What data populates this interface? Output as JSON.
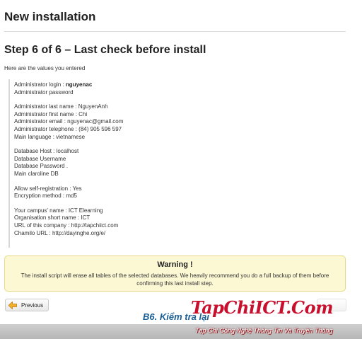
{
  "header": {
    "title": "New installation"
  },
  "step": {
    "title": "Step 6 of 6 – Last check before install"
  },
  "intro": "Here are the values you entered",
  "values": {
    "admin": [
      {
        "label": "Administrator login : ",
        "value": "nguyenac"
      },
      {
        "label": "Administrator password",
        "value": ""
      }
    ],
    "person": [
      {
        "label": "Administrator last name : ",
        "value": "NguyenAnh"
      },
      {
        "label": "Administrator first name : ",
        "value": "Chi"
      },
      {
        "label": "Administrator email : ",
        "value": "nguyenac@gmail.com"
      },
      {
        "label": "Administrator telephone : ",
        "value": "(84) 905 596 597"
      },
      {
        "label": "Main language : ",
        "value": "vietnamese"
      }
    ],
    "database": [
      {
        "label": "Database Host : ",
        "value": "localhost"
      },
      {
        "label": "Database Username",
        "value": ""
      },
      {
        "label": "Database Password",
        "value": "."
      },
      {
        "label": "Main claroline DB",
        "value": ""
      }
    ],
    "settings": [
      {
        "label": "Allow self-registration : ",
        "value": "Yes"
      },
      {
        "label": "Encryption method : ",
        "value": "md5"
      }
    ],
    "campus": [
      {
        "label": "Your campus' name : ",
        "value": "ICT Elearning"
      },
      {
        "label": "Organisation short name : ",
        "value": "ICT"
      },
      {
        "label": "URL of this company : ",
        "value": "http://tapchiict.com"
      },
      {
        "label": "Chamilo URL : ",
        "value": "http://dayinghe.org/e/"
      }
    ]
  },
  "warning": {
    "title": "Warning !",
    "text": "The install script will erase all tables of the selected databases. We heavily recommend you do a full backup of them before confirming this last install step."
  },
  "buttons": {
    "previous": "Previous"
  },
  "overlay": {
    "caption": "B6. Kiểm tra lại",
    "watermark": "TapChiICT.Com",
    "tagline": "Tạp Chí Công Nghệ Thông Tin Và Truyền Thông"
  },
  "colors": {
    "warning_bg": "#fcf8d4",
    "caption": "#1a5f96",
    "watermark": "#c8102e"
  }
}
